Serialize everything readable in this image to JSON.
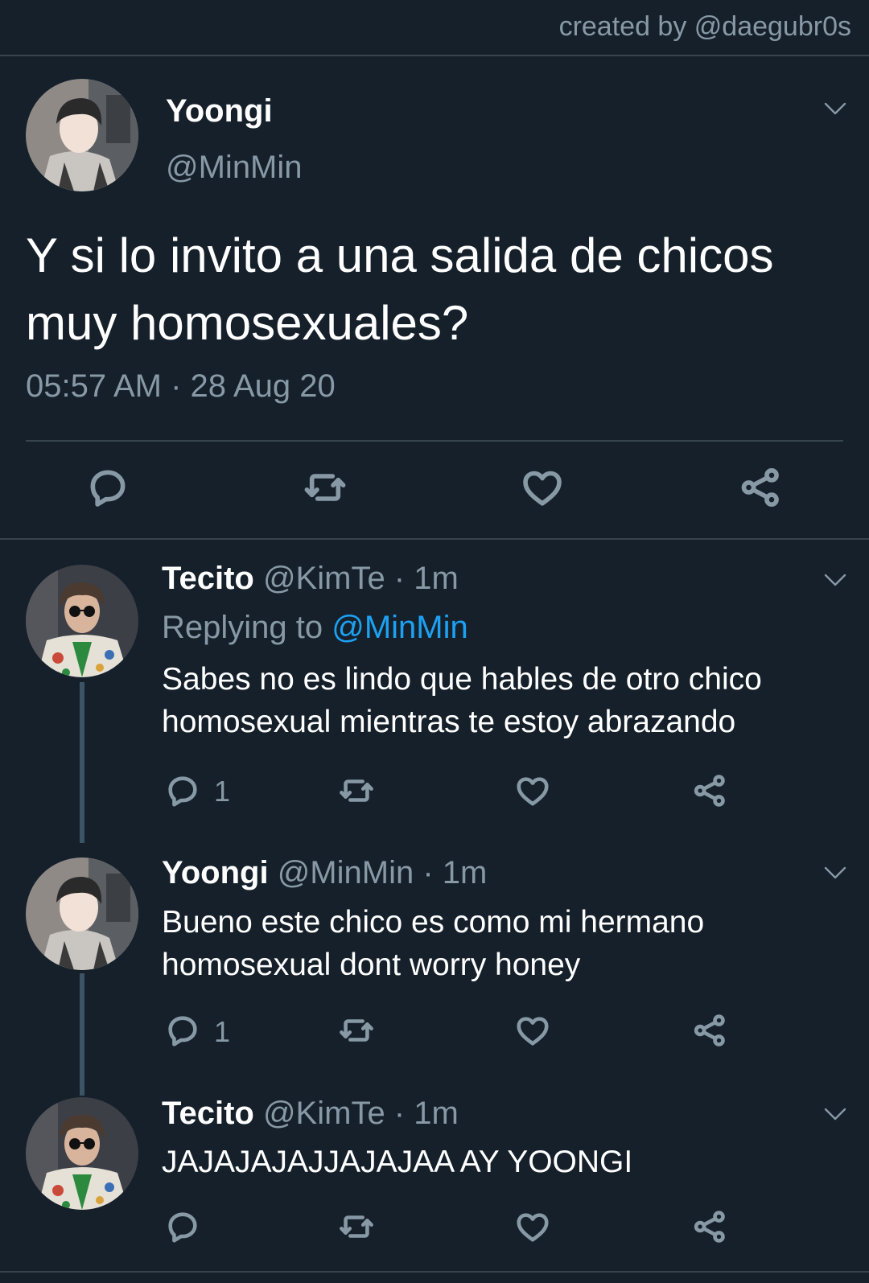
{
  "watermark": "created by @daegubr0s",
  "colors": {
    "background": "#15202b",
    "divider": "#38444d",
    "secondary_text": "#8899a6",
    "link": "#1da1f2"
  },
  "main_tweet": {
    "name": "Yoongi",
    "handle": "@MinMin",
    "text": "Y si lo invito a una salida de chicos muy homosexuales?",
    "timestamp": "05:57 AM · 28 Aug 20",
    "actions": [
      "reply-icon",
      "retweet-icon",
      "like-icon",
      "share-icon"
    ]
  },
  "replies": [
    {
      "name": "Tecito",
      "meta": "@KimTe · 1m",
      "replying_prefix": "Replying to ",
      "replying_handle": "@MinMin",
      "text": "Sabes no es lindo que hables de otro chico homosexual mientras te estoy abrazando",
      "reply_count": "1"
    },
    {
      "name": "Yoongi",
      "meta": "@MinMin · 1m",
      "text": "Bueno este chico es como mi hermano homosexual dont worry honey",
      "reply_count": "1"
    },
    {
      "name": "Tecito",
      "meta": "@KimTe · 1m",
      "text": "JAJAJAJAJJAJAJAA AY YOONGI"
    }
  ]
}
